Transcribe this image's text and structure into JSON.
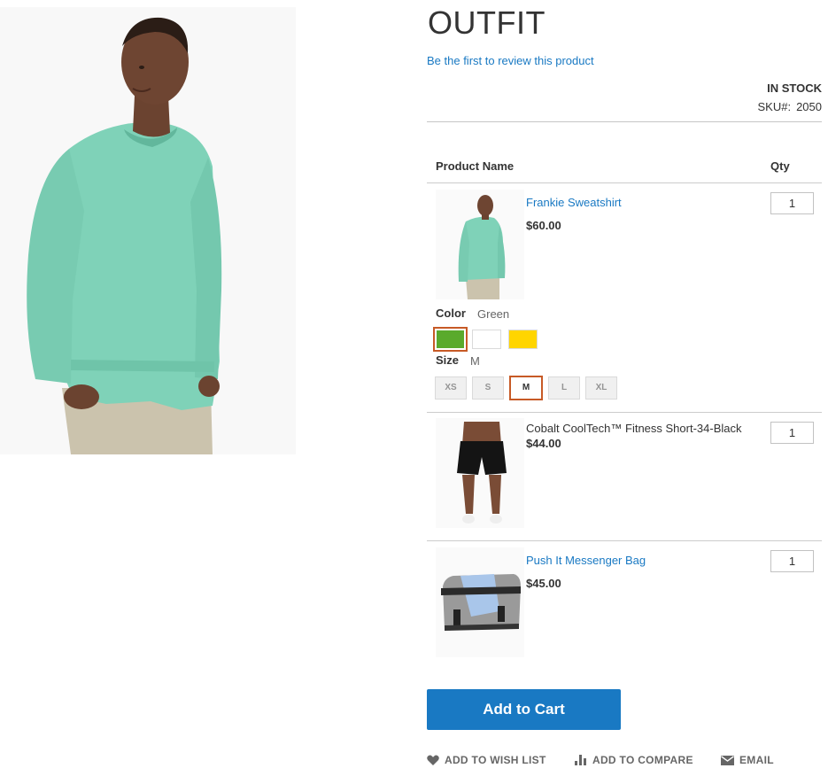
{
  "product": {
    "title": "OUTFIT",
    "review_link": "Be the first to review this product",
    "stock": "IN STOCK",
    "sku_label": "SKU#:",
    "sku_value": "2050"
  },
  "table": {
    "col_name": "Product Name",
    "col_qty": "Qty"
  },
  "items": [
    {
      "name": "Frankie Sweatshirt",
      "price": "$60.00",
      "qty": "1",
      "linked": true,
      "color_label": "Color",
      "color_value": "Green",
      "colors": [
        "#5aaa2c",
        "#ffffff",
        "#ffd500"
      ],
      "size_label": "Size",
      "size_value": "M",
      "sizes": [
        "XS",
        "S",
        "M",
        "L",
        "XL"
      ]
    },
    {
      "name": "Cobalt CoolTech™ Fitness Short-34-Black",
      "price": "$44.00",
      "qty": "1",
      "linked": false
    },
    {
      "name": "Push It Messenger Bag",
      "price": "$45.00",
      "qty": "1",
      "linked": true
    }
  ],
  "actions": {
    "add_to_cart": "Add to Cart",
    "wish_list": "ADD TO WISH LIST",
    "compare": "ADD TO COMPARE",
    "email": "EMAIL"
  },
  "icons": {
    "wish_list": "heart-icon",
    "compare": "bar-chart-icon",
    "email": "envelope-icon"
  },
  "colors": {
    "link": "#1979c3",
    "button": "#1979c3",
    "selected_border": "#c75a26"
  }
}
